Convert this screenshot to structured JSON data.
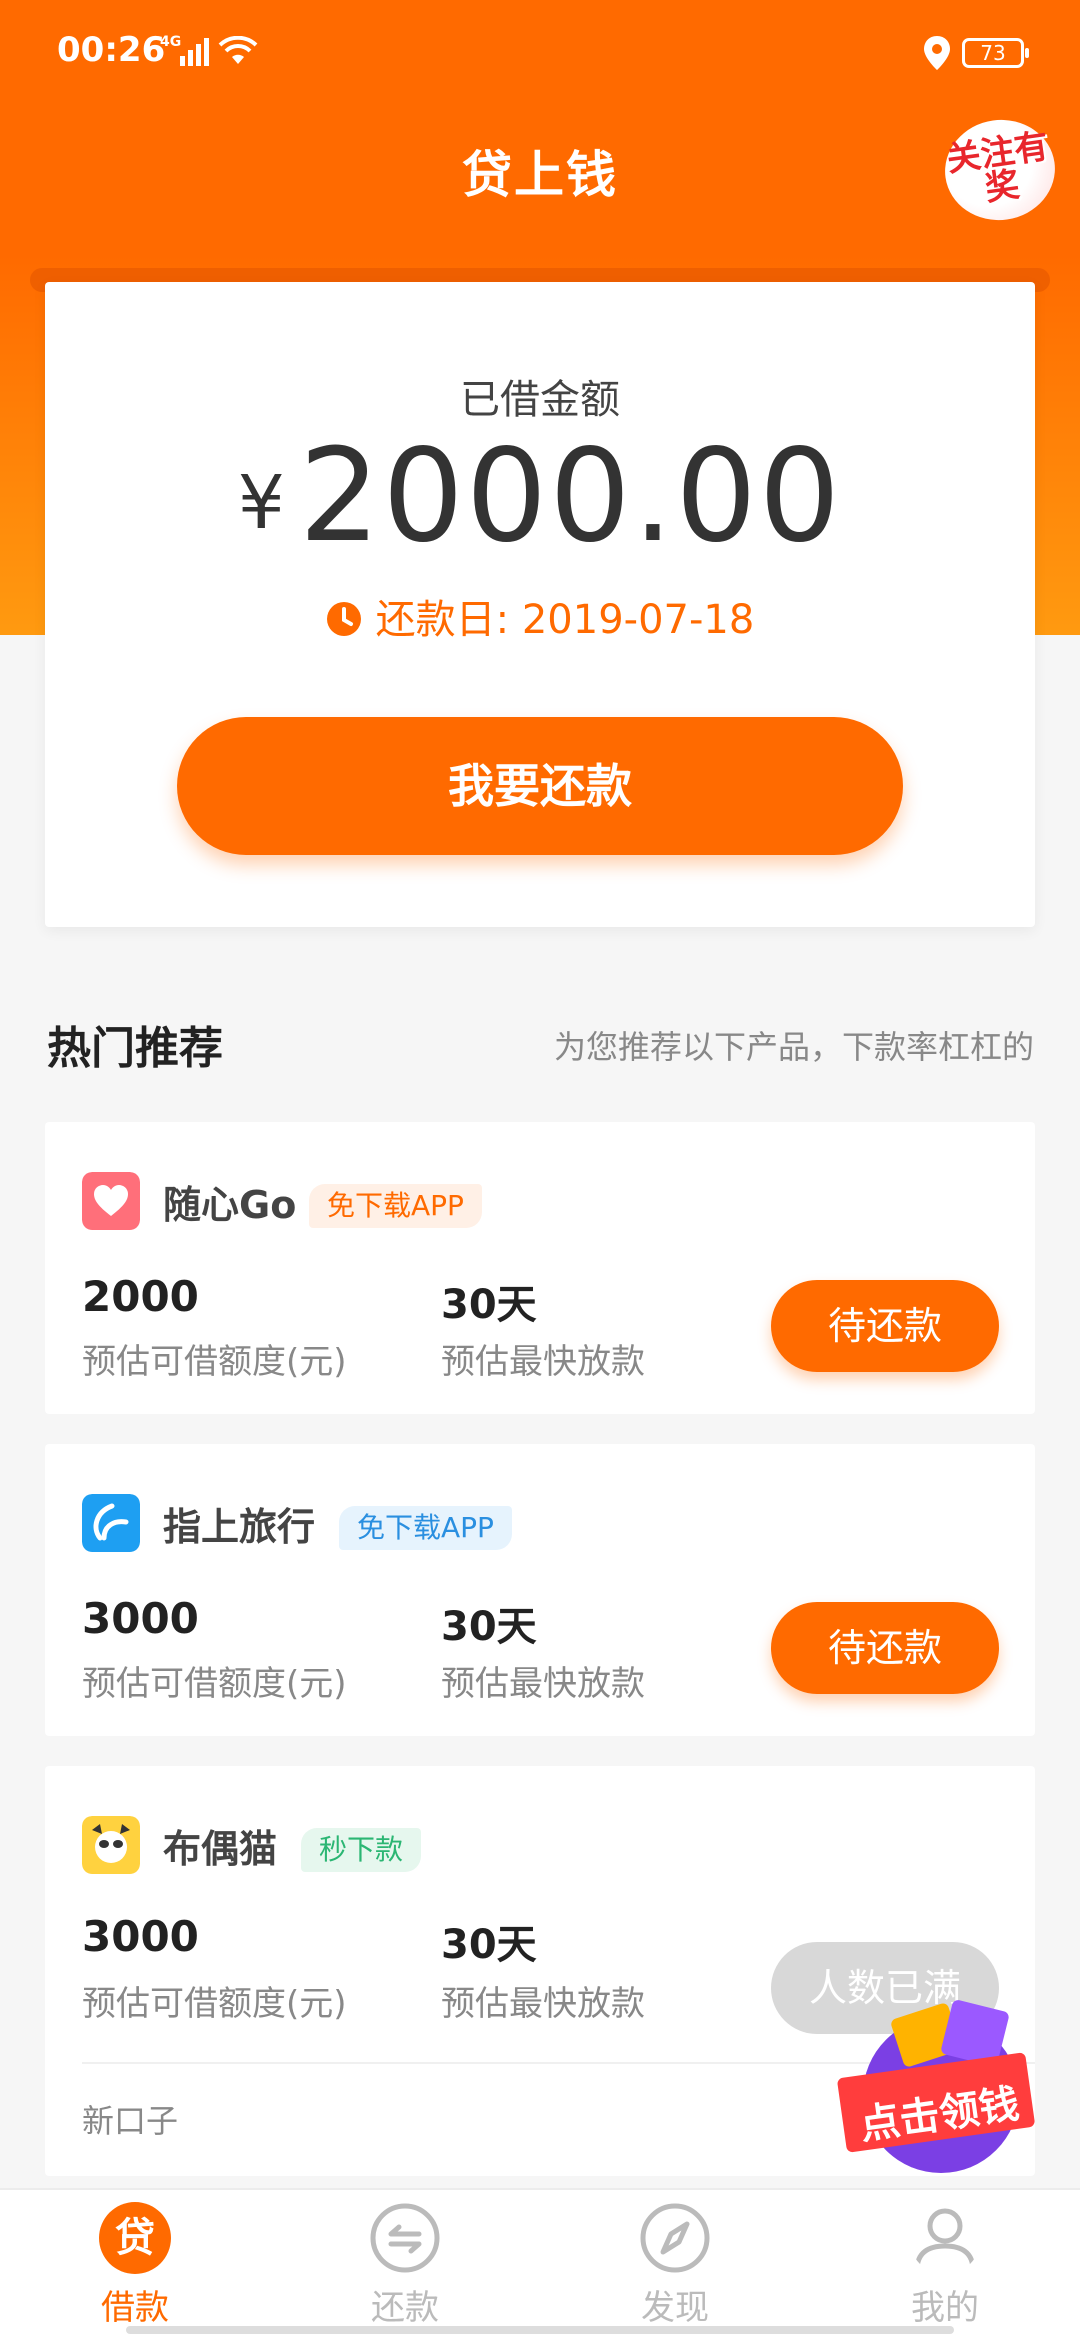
{
  "status_bar": {
    "time": "00:26",
    "network": "4G",
    "battery": "73"
  },
  "header": {
    "title": "贷上钱",
    "promo_badge": "关注有奖"
  },
  "loan": {
    "label": "已借金额",
    "currency": "¥",
    "amount": "2000.00",
    "due_label": "还款日: 2019-07-18",
    "repay_button": "我要还款"
  },
  "recommend": {
    "title": "热门推荐",
    "subtitle": "为您推荐以下产品，下款率杠杠的"
  },
  "products": [
    {
      "name": "随心Go",
      "tag": "免下载APP",
      "tag_color": "#ff6a00",
      "tag_bg": "#fff0e6",
      "amount": "2000",
      "amount_label": "预估可借额度(元)",
      "days": "30天",
      "days_label": "预估最快放款",
      "button": "待还款",
      "icon_color": "#ff6f7a"
    },
    {
      "name": "指上旅行",
      "tag": "免下载APP",
      "tag_color": "#2a8fe0",
      "tag_bg": "#e6f3fd",
      "amount": "3000",
      "amount_label": "预估可借额度(元)",
      "days": "30天",
      "days_label": "预估最快放款",
      "button": "待还款",
      "icon_color": "#1e9ff2"
    },
    {
      "name": "布偶猫",
      "tag": "秒下款",
      "tag_color": "#2bb673",
      "tag_bg": "#e6f7ee",
      "amount": "3000",
      "amount_label": "预估可借额度(元)",
      "days": "30天",
      "days_label": "预估最快放款",
      "button": "人数已满",
      "footer": "新口子",
      "icon_color": "#ffd23f"
    }
  ],
  "float_promo": {
    "label": "点击领钱"
  },
  "tabs": [
    {
      "label": "借款",
      "icon_glyph": "贷"
    },
    {
      "label": "还款"
    },
    {
      "label": "发现"
    },
    {
      "label": "我的"
    }
  ]
}
